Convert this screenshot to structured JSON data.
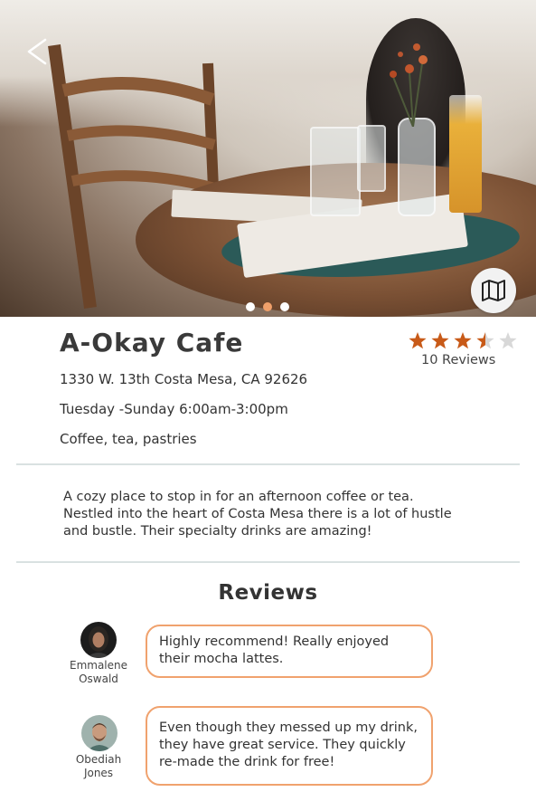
{
  "hero": {
    "back_icon": "chevron-left-icon",
    "map_icon": "map-icon",
    "carousel": {
      "count": 3,
      "active_index": 1
    }
  },
  "cafe": {
    "name": "A-Okay Cafe",
    "rating": 3.5,
    "rating_max": 5,
    "reviews_label": "10 Reviews",
    "address": "1330 W. 13th Costa Mesa, CA 92626",
    "hours": "Tuesday -Sunday  6:00am-3:00pm",
    "offerings": "Coffee, tea, pastries",
    "description": "A cozy place to stop in for an afternoon coffee or tea. Nestled into the heart of Costa Mesa there is a lot of hustle and bustle. Their specialty drinks are amazing!"
  },
  "reviews": {
    "title": "Reviews",
    "items": [
      {
        "first": "Emmalene",
        "last": "Oswald",
        "text": "Highly recommend! Really enjoyed their mocha lattes."
      },
      {
        "first": "Obediah",
        "last": "Jones",
        "text": "Even though they messed up my drink, they have great service. They quickly re-made the drink for free!"
      }
    ]
  },
  "colors": {
    "accent": "#f0a06a",
    "star": "#c85a18",
    "star_empty": "#d8d8d8",
    "divider": "#d9e1e1"
  }
}
